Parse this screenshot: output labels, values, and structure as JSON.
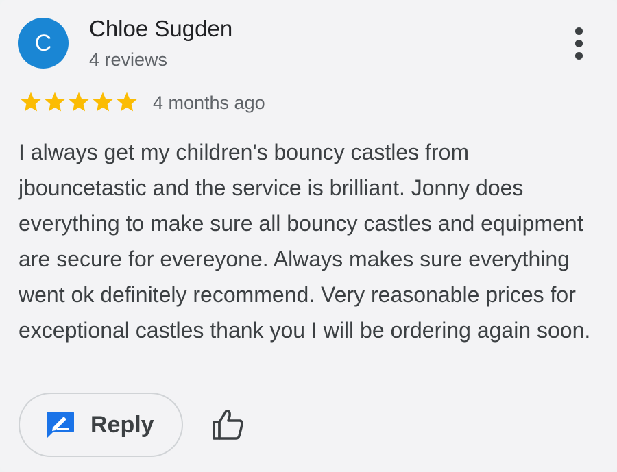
{
  "review": {
    "avatar_letter": "C",
    "author_name": "Chloe Sugden",
    "author_reviews": "4 reviews",
    "rating": 5,
    "rating_max": 5,
    "date": "4 months ago",
    "text": "I always get my children's bouncy castles from jbouncetastic and the service is brilliant. Jonny does everything to make sure all bouncy castles and equipment are secure for evereyone. Always makes sure everything went ok definitely recommend. Very reasonable prices for exceptional castles thank you I will be ordering again soon."
  },
  "actions": {
    "reply_label": "Reply",
    "reply_icon": "reply-edit-icon",
    "like_icon": "thumbs-up-icon",
    "more_icon": "more-vert-icon"
  },
  "colors": {
    "avatar_bg": "#1a86d4",
    "star": "#fbbc04",
    "reply_icon": "#1a73e8",
    "background": "#f3f3f5"
  }
}
